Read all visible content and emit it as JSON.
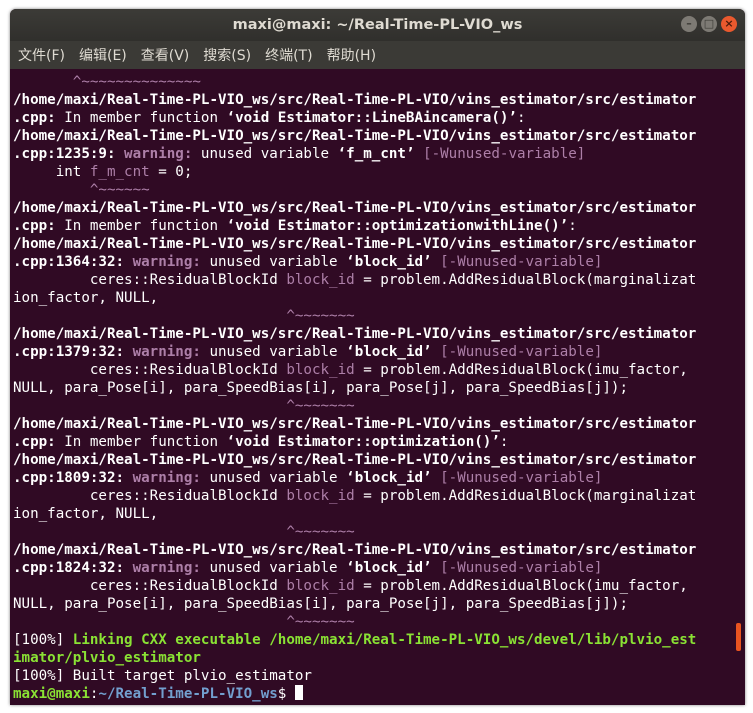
{
  "window": {
    "title": "maxi@maxi: ~/Real-Time-PL-VIO_ws"
  },
  "menu": [
    "文件(F)",
    "编辑(E)",
    "查看(V)",
    "搜索(S)",
    "终端(T)",
    "帮助(H)"
  ],
  "terminal": {
    "lines": [
      [
        {
          "t": "       ^~~~~~~~~~~~~~~",
          "c": "m"
        }
      ],
      [
        {
          "t": "/home/maxi/Real-Time-PL-VIO_ws/src/Real-Time-PL-VIO/vins_estimator/src/estimator",
          "c": "b"
        }
      ],
      [
        {
          "t": ".cpp:",
          "c": "b"
        },
        {
          "t": " In member function "
        },
        {
          "t": "‘void Estimator::LineBAincamera()’",
          "c": "b"
        },
        {
          "t": ":"
        }
      ],
      [
        {
          "t": "/home/maxi/Real-Time-PL-VIO_ws/src/Real-Time-PL-VIO/vins_estimator/src/estimator",
          "c": "b"
        }
      ],
      [
        {
          "t": ".cpp:1235:9:",
          "c": "b"
        },
        {
          "t": " "
        },
        {
          "t": "warning:",
          "c": "mb"
        },
        {
          "t": " unused variable "
        },
        {
          "t": "‘f_m_cnt’",
          "c": "b"
        },
        {
          "t": " "
        },
        {
          "t": "[-Wunused-variable]",
          "c": "m"
        }
      ],
      [
        {
          "t": "     int "
        },
        {
          "t": "f_m_cnt",
          "c": "m"
        },
        {
          "t": " = 0;"
        }
      ],
      [
        {
          "t": "         ^~~~~~~",
          "c": "m"
        }
      ],
      [
        {
          "t": "/home/maxi/Real-Time-PL-VIO_ws/src/Real-Time-PL-VIO/vins_estimator/src/estimator",
          "c": "b"
        }
      ],
      [
        {
          "t": ".cpp:",
          "c": "b"
        },
        {
          "t": " In member function "
        },
        {
          "t": "‘void Estimator::optimizationwithLine()’",
          "c": "b"
        },
        {
          "t": ":"
        }
      ],
      [
        {
          "t": "/home/maxi/Real-Time-PL-VIO_ws/src/Real-Time-PL-VIO/vins_estimator/src/estimator",
          "c": "b"
        }
      ],
      [
        {
          "t": ".cpp:1364:32:",
          "c": "b"
        },
        {
          "t": " "
        },
        {
          "t": "warning:",
          "c": "mb"
        },
        {
          "t": " unused variable "
        },
        {
          "t": "‘block_id’",
          "c": "b"
        },
        {
          "t": " "
        },
        {
          "t": "[-Wunused-variable]",
          "c": "m"
        }
      ],
      [
        {
          "t": "         ceres::ResidualBlockId "
        },
        {
          "t": "block_id",
          "c": "m"
        },
        {
          "t": " = problem.AddResidualBlock(marginalizat"
        }
      ],
      [
        {
          "t": "ion_factor, NULL,"
        }
      ],
      [
        {
          "t": "                                ^~~~~~~~",
          "c": "m"
        }
      ],
      [
        {
          "t": "/home/maxi/Real-Time-PL-VIO_ws/src/Real-Time-PL-VIO/vins_estimator/src/estimator",
          "c": "b"
        }
      ],
      [
        {
          "t": ".cpp:1379:32:",
          "c": "b"
        },
        {
          "t": " "
        },
        {
          "t": "warning:",
          "c": "mb"
        },
        {
          "t": " unused variable "
        },
        {
          "t": "‘block_id’",
          "c": "b"
        },
        {
          "t": " "
        },
        {
          "t": "[-Wunused-variable]",
          "c": "m"
        }
      ],
      [
        {
          "t": "         ceres::ResidualBlockId "
        },
        {
          "t": "block_id",
          "c": "m"
        },
        {
          "t": " = problem.AddResidualBlock(imu_factor,"
        }
      ],
      [
        {
          "t": "NULL, para_Pose[i], para_SpeedBias[i], para_Pose[j], para_SpeedBias[j]);"
        }
      ],
      [
        {
          "t": "                                ^~~~~~~~",
          "c": "m"
        }
      ],
      [
        {
          "t": "/home/maxi/Real-Time-PL-VIO_ws/src/Real-Time-PL-VIO/vins_estimator/src/estimator",
          "c": "b"
        }
      ],
      [
        {
          "t": ".cpp:",
          "c": "b"
        },
        {
          "t": " In member function "
        },
        {
          "t": "‘void Estimator::optimization()’",
          "c": "b"
        },
        {
          "t": ":"
        }
      ],
      [
        {
          "t": "/home/maxi/Real-Time-PL-VIO_ws/src/Real-Time-PL-VIO/vins_estimator/src/estimator",
          "c": "b"
        }
      ],
      [
        {
          "t": ".cpp:1809:32:",
          "c": "b"
        },
        {
          "t": " "
        },
        {
          "t": "warning:",
          "c": "mb"
        },
        {
          "t": " unused variable "
        },
        {
          "t": "‘block_id’",
          "c": "b"
        },
        {
          "t": " "
        },
        {
          "t": "[-Wunused-variable]",
          "c": "m"
        }
      ],
      [
        {
          "t": "         ceres::ResidualBlockId "
        },
        {
          "t": "block_id",
          "c": "m"
        },
        {
          "t": " = problem.AddResidualBlock(marginalizat"
        }
      ],
      [
        {
          "t": "ion_factor, NULL,"
        }
      ],
      [
        {
          "t": "                                ^~~~~~~~",
          "c": "m"
        }
      ],
      [
        {
          "t": "/home/maxi/Real-Time-PL-VIO_ws/src/Real-Time-PL-VIO/vins_estimator/src/estimator",
          "c": "b"
        }
      ],
      [
        {
          "t": ".cpp:1824:32:",
          "c": "b"
        },
        {
          "t": " "
        },
        {
          "t": "warning:",
          "c": "mb"
        },
        {
          "t": " unused variable "
        },
        {
          "t": "‘block_id’",
          "c": "b"
        },
        {
          "t": " "
        },
        {
          "t": "[-Wunused-variable]",
          "c": "m"
        }
      ],
      [
        {
          "t": "         ceres::ResidualBlockId "
        },
        {
          "t": "block_id",
          "c": "m"
        },
        {
          "t": " = problem.AddResidualBlock(imu_factor,"
        }
      ],
      [
        {
          "t": "NULL, para_Pose[i], para_SpeedBias[i], para_Pose[j], para_SpeedBias[j]);"
        }
      ],
      [
        {
          "t": "                                ^~~~~~~~",
          "c": "m"
        }
      ],
      [
        {
          "t": "[100%] "
        },
        {
          "t": "Linking CXX executable /home/maxi/Real-Time-PL-VIO_ws/devel/lib/plvio_est",
          "c": "g"
        }
      ],
      [
        {
          "t": "imator/plvio_estimator",
          "c": "g"
        }
      ],
      [
        {
          "t": "[100%] Built target plvio_estimator"
        }
      ]
    ],
    "prompt": {
      "user_host": "maxi@maxi",
      "sep": ":",
      "path": "~/Real-Time-PL-VIO_ws",
      "symbol": "$ "
    }
  },
  "colors": {
    "background": "#300a24",
    "accent": "#e95420"
  }
}
